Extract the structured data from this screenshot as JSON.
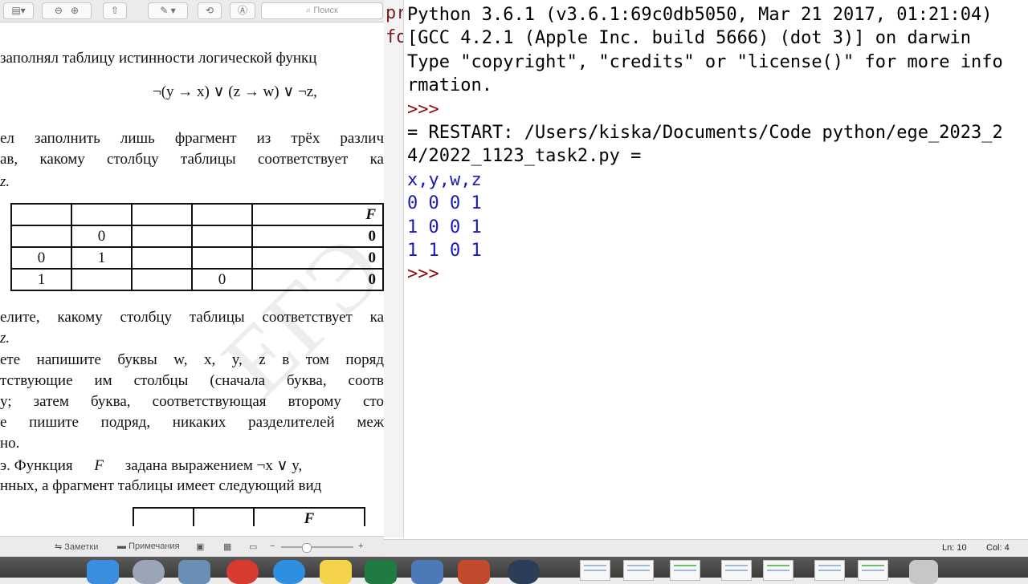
{
  "preview": {
    "toolbar": {
      "search_placeholder": "Поиск"
    },
    "page": {
      "line1": "заполнял таблицу истинности логической функц",
      "formula": "¬(y → x) ∨ (z → w) ∨ ¬z,",
      "line2": "ел заполнить лишь фрагмент из трёх различ",
      "line3": "ав, какому столбцу таблицы соответствует ка",
      "line4": "z.",
      "table1": {
        "header_f": "F",
        "rows": [
          [
            "",
            "0",
            "",
            "",
            "0"
          ],
          [
            "0",
            "1",
            "",
            "",
            "0"
          ],
          [
            "1",
            "",
            "",
            "0",
            "0"
          ]
        ]
      },
      "line5": "елите, какому столбцу таблицы соответствует ка",
      "line6": "z.",
      "line7": "ете напишите буквы w, x, y, z в том поряд",
      "line8": "тствующие им столбцы (сначала буква, соотв",
      "line9": "у; затем буква, соответствующая второму сто",
      "line10": "е пишите подряд, никаких разделителей меж",
      "line11": "но.",
      "line12_a": "э.  Функция",
      "line12_f": "F",
      "line12_b": "задана   выражением   ¬x ∨ y,",
      "line13": "нных, а фрагмент таблицы имеет следующий вид",
      "table2": {
        "header_f": "F"
      },
      "watermark": "ЕГЭ"
    },
    "status": {
      "notes": "Заметки",
      "comments": "Примечания"
    }
  },
  "idle": {
    "gutter": [
      "pr",
      "fo"
    ],
    "lines": [
      {
        "text": "Python 3.6.1 (v3.6.1:69c0db5050, Mar 21 2017, 01:21:04)",
        "kind": "text"
      },
      {
        "text": "[GCC 4.2.1 (Apple Inc. build 5666) (dot 3)] on darwin",
        "kind": "text"
      },
      {
        "text": "Type \"copyright\", \"credits\" or \"license()\" for more info",
        "kind": "text"
      },
      {
        "text": "rmation.",
        "kind": "text"
      },
      {
        "text": ">>>",
        "kind": "prompt"
      },
      {
        "text": "= RESTART: /Users/kiska/Documents/Code python/ege_2023_2",
        "kind": "text"
      },
      {
        "text": "4/2022_1123_task2.py =",
        "kind": "text"
      },
      {
        "text": "x,y,w,z",
        "kind": "out"
      },
      {
        "text": "0 0 0 1",
        "kind": "out"
      },
      {
        "text": "1 0 0 1",
        "kind": "out"
      },
      {
        "text": "1 1 0 1",
        "kind": "out"
      },
      {
        "text": ">>> ",
        "kind": "prompt"
      }
    ],
    "status": {
      "ln": "Ln: 10",
      "col": "Col: 4"
    }
  },
  "colors": {
    "prompt": "#8a1010",
    "output": "#1a1ab8"
  }
}
